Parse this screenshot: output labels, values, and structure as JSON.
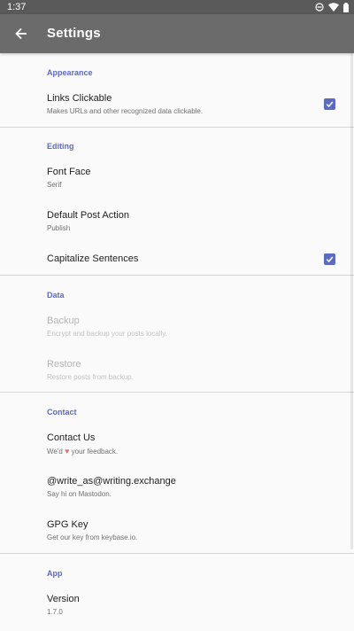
{
  "status_bar": {
    "time": "1:37",
    "icons": [
      "do-not-disturb-icon",
      "wifi-icon",
      "battery-icon"
    ]
  },
  "app_bar": {
    "title": "Settings",
    "back_icon": "arrow-back-icon"
  },
  "accent_color": "#5c6bc0",
  "sections": {
    "appearance": {
      "header": "Appearance",
      "links_clickable": {
        "title": "Links Clickable",
        "summary": "Makes URLs and other recognized data clickable.",
        "checked": true
      }
    },
    "editing": {
      "header": "Editing",
      "font_face": {
        "title": "Font Face",
        "summary": "Serif"
      },
      "default_post_action": {
        "title": "Default Post Action",
        "summary": "Publish"
      },
      "capitalize_sentences": {
        "title": "Capitalize Sentences",
        "checked": true
      }
    },
    "data": {
      "header": "Data",
      "backup": {
        "title": "Backup",
        "summary": "Encrypt and backup your posts locally.",
        "enabled": false
      },
      "restore": {
        "title": "Restore",
        "summary": "Restore posts from backup.",
        "enabled": false
      }
    },
    "contact": {
      "header": "Contact",
      "contact_us": {
        "title": "Contact Us",
        "summary_before": "We'd",
        "summary_heart": "♥",
        "summary_after": "your feedback."
      },
      "mastodon": {
        "title": "@write_as@writing.exchange",
        "summary": "Say hi on Mastodon."
      },
      "gpg_key": {
        "title": "GPG Key",
        "summary": "Get our key from keybase.io."
      }
    },
    "app": {
      "header": "App",
      "version": {
        "title": "Version",
        "summary": "1.7.0"
      }
    }
  }
}
